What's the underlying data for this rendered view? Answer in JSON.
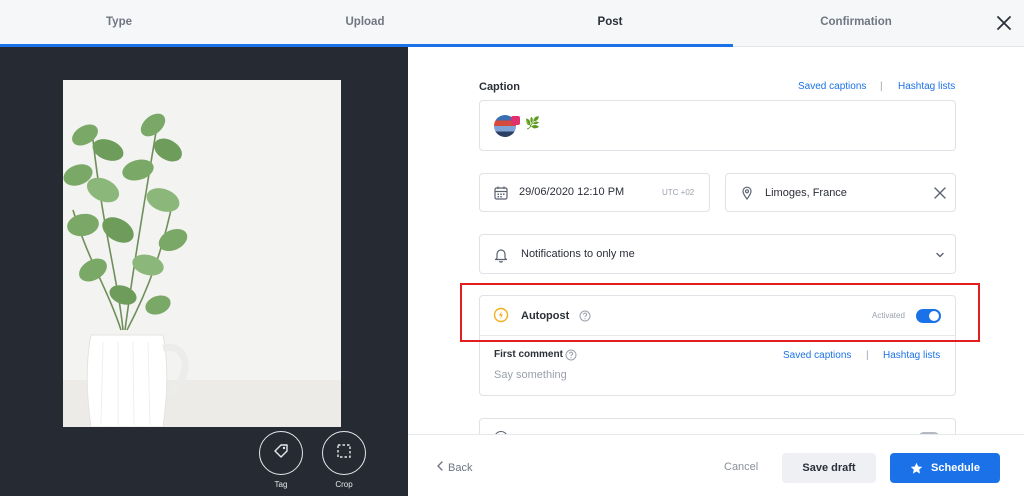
{
  "steps": {
    "type": "Type",
    "upload": "Upload",
    "post": "Post",
    "confirmation": "Confirmation"
  },
  "tools": {
    "tag": "Tag",
    "crop": "Crop"
  },
  "caption": {
    "label": "Caption",
    "saved_captions": "Saved captions",
    "separator": "|",
    "hashtag_lists": "Hashtag lists",
    "emoji": "🌿"
  },
  "schedule": {
    "datetime": "29/06/2020 12:10 PM",
    "timezone": "UTC +02",
    "location": "Limoges, France"
  },
  "notifications": {
    "value": "Notifications to only me"
  },
  "autopost": {
    "label": "Autopost",
    "status": "Activated",
    "enabled": true
  },
  "first_comment": {
    "label": "First comment",
    "saved_captions": "Saved captions",
    "separator": "|",
    "hashtag_lists": "Hashtag lists",
    "placeholder": "Say something"
  },
  "footer": {
    "back": "Back",
    "cancel": "Cancel",
    "save_draft": "Save draft",
    "schedule": "Schedule"
  },
  "colors": {
    "accent": "#1b72e8",
    "highlight": "#e31d1d",
    "dark_panel": "#262b33",
    "warning": "#f2b01e"
  }
}
